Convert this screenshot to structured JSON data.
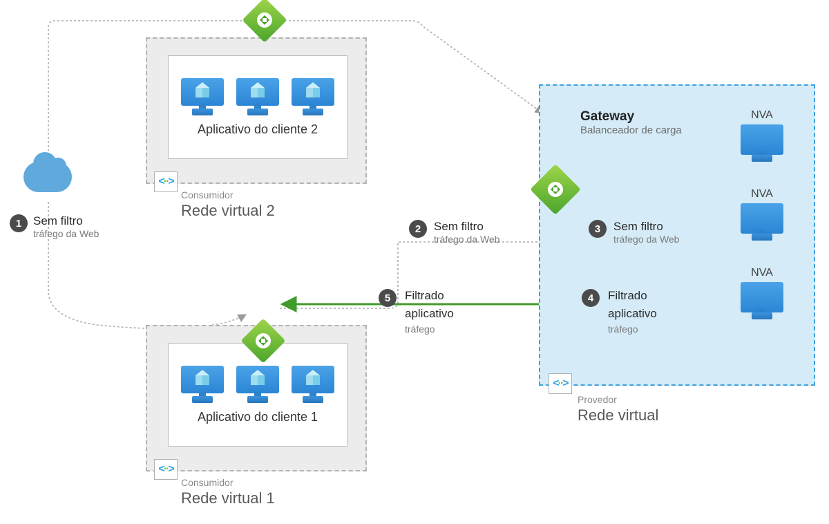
{
  "cloud": {},
  "vnets": {
    "consumer2": {
      "app_label": "Aplicativo do cliente 2",
      "sup": "Consumidor",
      "name": "Rede virtual 2"
    },
    "consumer1": {
      "app_label": "Aplicativo do cliente 1",
      "sup": "Consumidor",
      "name": "Rede virtual 1"
    },
    "provider": {
      "sup": "Provedor",
      "name": "Rede virtual"
    }
  },
  "gateway": {
    "title": "Gateway",
    "subtitle": "Balanceador de carga"
  },
  "nva": {
    "label": "NVA"
  },
  "steps": {
    "s1": {
      "num": "1",
      "title": "Sem filtro",
      "sub": "tráfego da Web"
    },
    "s2": {
      "num": "2",
      "title": "Sem filtro",
      "sub": "tráfego da Web"
    },
    "s3": {
      "num": "3",
      "title": "Sem filtro",
      "sub": "tráfego da Web"
    },
    "s4": {
      "num": "4",
      "title": "Filtrado",
      "sub1": "aplicativo",
      "sub2": "tráfego"
    },
    "s5": {
      "num": "5",
      "title": "Filtrado",
      "sub1": "aplicativo",
      "sub2": "tráfego"
    }
  }
}
